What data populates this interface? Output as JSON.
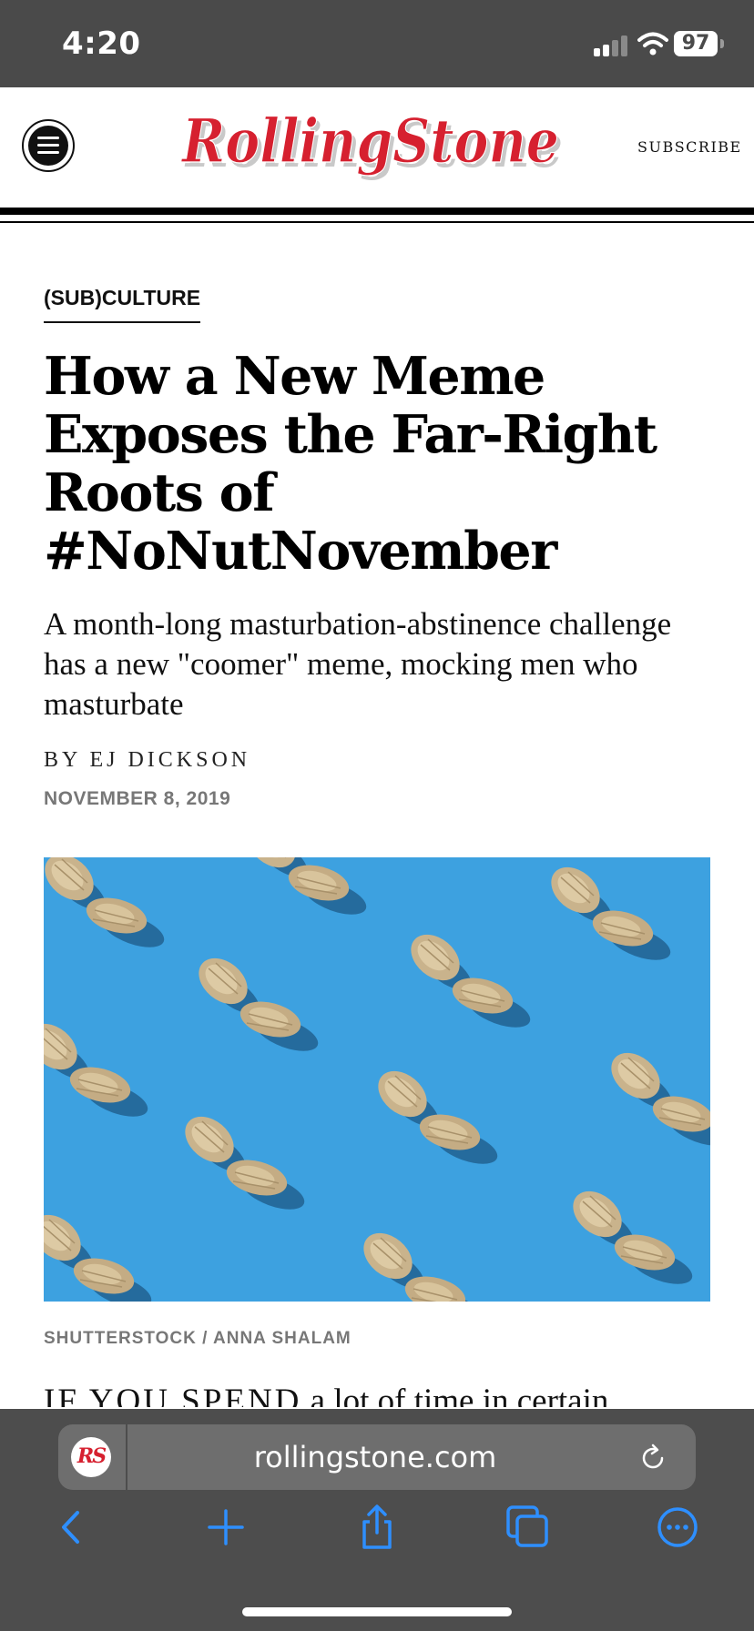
{
  "status_bar": {
    "time": "4:20",
    "battery": "97"
  },
  "site": {
    "logo_text": "RollingStone",
    "subscribe_label": "SUBSCRIBE"
  },
  "article": {
    "kicker": "(SUB)CULTURE",
    "headline_lines": [
      "How a New Meme",
      "Exposes the Far-Right",
      "Roots of",
      "#NoNutNovember"
    ],
    "dek": "A month-long masturbation-abstinence challenge has a new \"coomer\" meme, mocking men who masturbate",
    "byline": "BY EJ DICKSON",
    "date": "NOVEMBER 8, 2019",
    "image_credit": "SHUTTERSTOCK / ANNA SHALAM",
    "body_start_caps": "IF YOU SPEND",
    "body_start_rest": " a lot of time in certain"
  },
  "browser": {
    "url": "rollingstone.com",
    "favicon_text": "RS",
    "icons": [
      "back-icon",
      "new-tab-icon",
      "share-icon",
      "tabs-icon",
      "more-icon",
      "reload-icon"
    ]
  },
  "colors": {
    "brand_red": "#d6202f",
    "hero_blue": "#3da1e0",
    "ios_blue": "#2e8fff",
    "toolbar_gray": "#4d4d4d"
  }
}
